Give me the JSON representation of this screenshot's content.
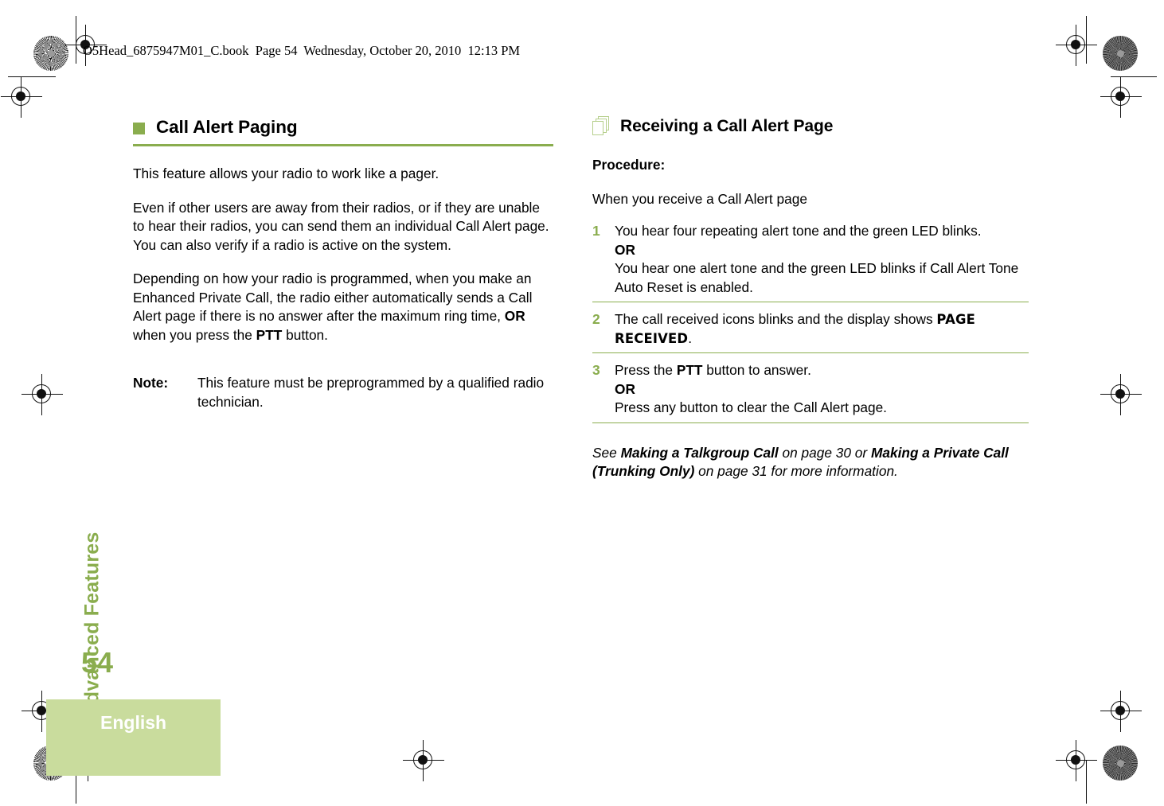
{
  "document": {
    "running_header": "O5Head_6875947M01_C.book  Page 54  Wednesday, October 20, 2010  12:13 PM",
    "page_number": "54",
    "language": "English",
    "chapter_tab": "Advanced Features",
    "accent_color": "#8aad4e",
    "tab_block_color": "#c9dc9d"
  },
  "left_column": {
    "section_title": "Call Alert Paging",
    "paragraphs": [
      "This feature allows your radio to work like a pager.",
      "Even if other users are away from their radios, or if they are unable to hear their radios, you can send them an individual Call Alert page. You can also verify if a radio is active on the system.",
      "Depending on how your radio is programmed, when you make an Enhanced Private Call, the radio either automatically sends a Call Alert page if there is no answer after the maximum ring time, "
    ],
    "para3_bold_1": "OR",
    "para3_mid": " when you press the ",
    "para3_bold_2": "PTT",
    "para3_end": " button.",
    "note_label": "Note:",
    "note_text": "This feature must be preprogrammed by a qualified radio technician."
  },
  "right_column": {
    "section_title": "Receiving a Call Alert Page",
    "icon": "stacked-pages-icon",
    "procedure_label": "Procedure:",
    "procedure_intro": "When you receive a Call Alert page",
    "steps": [
      {
        "number": "1",
        "line1": "You hear four repeating alert tone and the green LED blinks.",
        "or": "OR",
        "line2": "You hear one alert tone and the green LED blinks if Call Alert Tone Auto Reset is enabled."
      },
      {
        "number": "2",
        "prefix": "The call received icons blinks and the display shows ",
        "display_text": "PAGE RECEIVED",
        "suffix": "."
      },
      {
        "number": "3",
        "prefix": "Press the ",
        "bold": "PTT",
        "suffix": " button to answer.",
        "or": "OR",
        "line2": "Press any button to clear the Call Alert page."
      }
    ],
    "see_also": {
      "lead": "See ",
      "ref1": "Making a Talkgroup Call",
      "mid1": " on page 30 or ",
      "ref2": "Making a Private Call (Trunking Only)",
      "mid2": " on page 31 for more information."
    }
  }
}
